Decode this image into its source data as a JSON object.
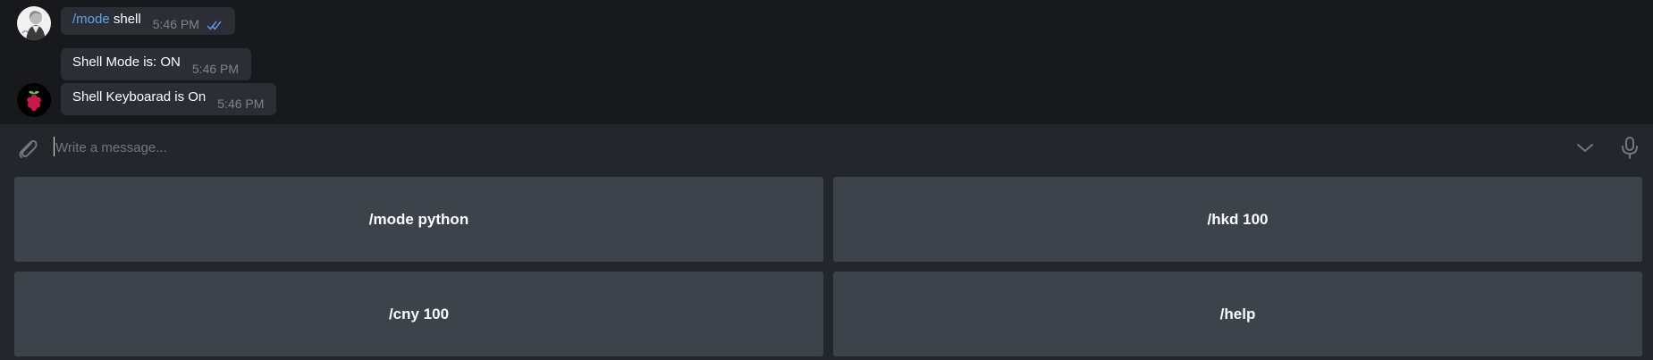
{
  "messages": [
    {
      "sender": "user",
      "command": "/mode",
      "text": " shell",
      "time": "5:46 PM",
      "status_icon": "double-check-icon"
    },
    {
      "sender": "bot",
      "text": "Shell Mode is: ON",
      "time": "5:46 PM"
    },
    {
      "sender": "bot",
      "text": "Shell Keyboarad is On",
      "time": "5:46 PM"
    }
  ],
  "avatars": {
    "user": "user-avatar",
    "bot": "raspberry-pi-avatar"
  },
  "composer": {
    "placeholder": "Write a message...",
    "value": "",
    "attach_icon": "paperclip-icon",
    "keyboard_toggle_icon": "chevron-down-icon",
    "mic_icon": "microphone-icon"
  },
  "keyboard": {
    "buttons": [
      {
        "label": "/mode python"
      },
      {
        "label": "/hkd 100"
      },
      {
        "label": "/cny 100"
      },
      {
        "label": "/help"
      }
    ]
  },
  "colors": {
    "background": "#17191c",
    "bubble": "#2b2f35",
    "composer": "#23272c",
    "keyboard_button": "#3d434b",
    "link": "#5ea2ec",
    "time": "#7b8490",
    "read_ticks": "#5ea2ec"
  }
}
